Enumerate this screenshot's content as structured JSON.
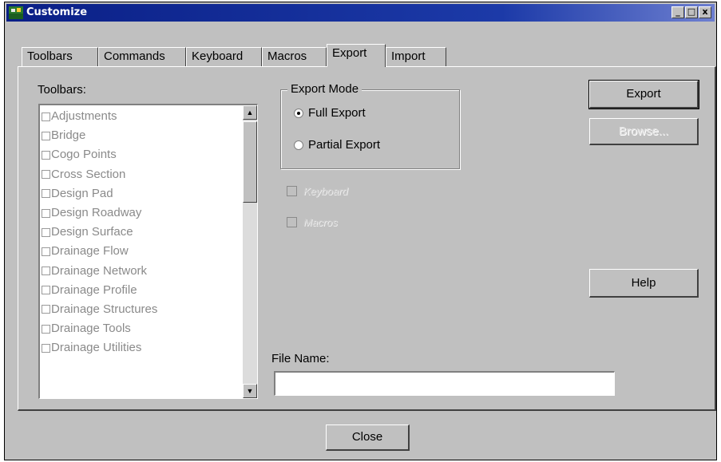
{
  "window": {
    "title": "Customize",
    "controls": {
      "minimize": "_",
      "maximize": "□",
      "close": "x"
    }
  },
  "tabs": [
    "Toolbars",
    "Commands",
    "Keyboard",
    "Macros",
    "Export",
    "Import"
  ],
  "active_tab": "Export",
  "export_panel": {
    "toolbars_label": "Toolbars:",
    "toolbars": [
      "Adjustments",
      "Bridge",
      "Cogo Points",
      "Cross Section",
      "Design Pad",
      "Design Roadway",
      "Design Surface",
      "Drainage Flow",
      "Drainage Network",
      "Drainage Profile",
      "Drainage Structures",
      "Drainage Tools",
      "Drainage Utilities"
    ],
    "export_mode": {
      "legend": "Export Mode",
      "full_label": "Full Export",
      "partial_label": "Partial Export",
      "selected": "Full Export"
    },
    "keyboard_label": "Keyboard",
    "macros_label": "Macros",
    "export_button": "Export",
    "browse_button": "Browse...",
    "help_button": "Help",
    "filename_label": "File Name:",
    "filename_value": ""
  },
  "close_button": "Close",
  "colors": {
    "titlebar": "#0a1f86",
    "face": "#c0c0c0",
    "disabled_text": "#8a8a8a"
  },
  "icons": {
    "app": "customize-app-icon"
  }
}
